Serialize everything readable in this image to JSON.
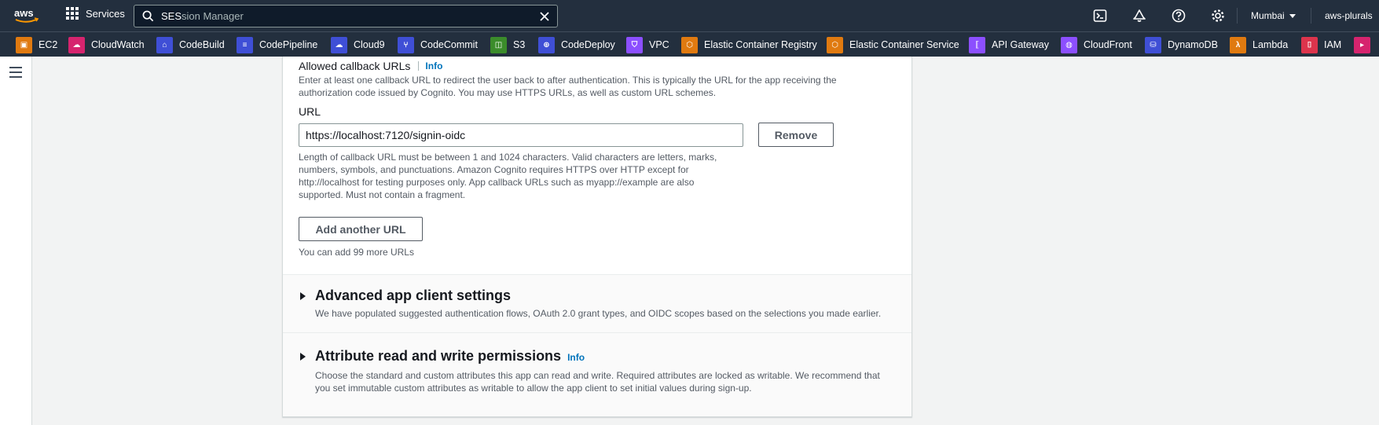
{
  "topnav": {
    "services_label": "Services",
    "search": {
      "typed": "SES",
      "suggestion": "sion Manager"
    },
    "region": "Mumbai",
    "account": "aws-plurals",
    "icons": [
      "cloudshell-icon",
      "notifications-icon",
      "help-icon",
      "settings-icon"
    ]
  },
  "favorites": [
    {
      "label": "EC2",
      "icon": "ec2-icon",
      "color": "#e07a10"
    },
    {
      "label": "CloudWatch",
      "icon": "cloudwatch-icon",
      "color": "#d6246e"
    },
    {
      "label": "CodeBuild",
      "icon": "codebuild-icon",
      "color": "#3f4fd6"
    },
    {
      "label": "CodePipeline",
      "icon": "codepipeline-icon",
      "color": "#3f4fd6"
    },
    {
      "label": "Cloud9",
      "icon": "cloud9-icon",
      "color": "#3f4fd6"
    },
    {
      "label": "CodeCommit",
      "icon": "codecommit-icon",
      "color": "#3f4fd6"
    },
    {
      "label": "S3",
      "icon": "s3-icon",
      "color": "#3b8c2b"
    },
    {
      "label": "CodeDeploy",
      "icon": "codedeploy-icon",
      "color": "#3f4fd6"
    },
    {
      "label": "VPC",
      "icon": "vpc-icon",
      "color": "#8c4fff"
    },
    {
      "label": "Elastic Container Registry",
      "icon": "ecr-icon",
      "color": "#e07a10"
    },
    {
      "label": "Elastic Container Service",
      "icon": "ecs-icon",
      "color": "#e07a10"
    },
    {
      "label": "API Gateway",
      "icon": "api-gateway-icon",
      "color": "#8c4fff"
    },
    {
      "label": "CloudFront",
      "icon": "cloudfront-icon",
      "color": "#8c4fff"
    },
    {
      "label": "DynamoDB",
      "icon": "dynamodb-icon",
      "color": "#3f4fd6"
    },
    {
      "label": "Lambda",
      "icon": "lambda-icon",
      "color": "#e07a10"
    },
    {
      "label": "IAM",
      "icon": "iam-icon",
      "color": "#dd344c"
    },
    {
      "label": "",
      "icon": "partial-service-icon",
      "color": "#d6246e"
    }
  ],
  "callback": {
    "label": "Allowed callback URLs",
    "info": "Info",
    "description_line1": "Enter at least one callback URL to redirect the user back to after authentication. This is typically the URL for the app receiving the",
    "description_line2": "authorization code issued by Cognito. You may use HTTPS URLs, as well as custom URL schemes.",
    "url_label": "URL",
    "url_value": "https://localhost:7120/signin-oidc",
    "remove_label": "Remove",
    "constraint_line1": "Length of callback URL must be between 1 and 1024 characters. Valid characters are letters, marks,",
    "constraint_line2": "numbers, symbols, and punctuations. Amazon Cognito requires HTTPS over HTTP except for",
    "constraint_line3": "http://localhost for testing purposes only. App callback URLs such as myapp://example are also",
    "constraint_line4": "supported. Must not contain a fragment.",
    "add_label": "Add another URL",
    "remaining_note": "You can add 99 more URLs"
  },
  "advanced": {
    "title": "Advanced app client settings",
    "description": "We have populated suggested authentication flows, OAuth 2.0 grant types, and OIDC scopes based on the selections you made earlier."
  },
  "attributes": {
    "title": "Attribute read and write permissions",
    "info": "Info",
    "description_line1": "Choose the standard and custom attributes this app can read and write. Required attributes are locked as writable. We recommend that",
    "description_line2": "you set immutable custom attributes as writable to allow the app client to set initial values during sign-up."
  },
  "colors": {
    "nav_bg": "#232f3e",
    "link": "#0073bb",
    "page_bg": "#f2f3f3"
  }
}
